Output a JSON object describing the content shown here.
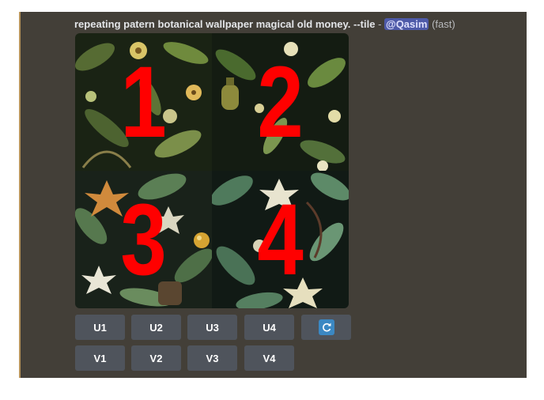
{
  "message": {
    "prompt": "repeating patern botanical wallpaper magical old money. --tile",
    "separator": " - ",
    "mention": "@Qasim",
    "speed": "(fast)"
  },
  "image_grid": {
    "tiles": [
      {
        "number": "1"
      },
      {
        "number": "2"
      },
      {
        "number": "3"
      },
      {
        "number": "4"
      }
    ]
  },
  "buttons": {
    "upscale": [
      "U1",
      "U2",
      "U3",
      "U4"
    ],
    "variation": [
      "V1",
      "V2",
      "V3",
      "V4"
    ],
    "reroll_icon": "reroll-icon"
  },
  "colors": {
    "background": "#433f38",
    "button": "#4f545c",
    "mention": "#4e5aa8",
    "number_overlay": "#ff0000",
    "reroll": "#3b88c3"
  }
}
